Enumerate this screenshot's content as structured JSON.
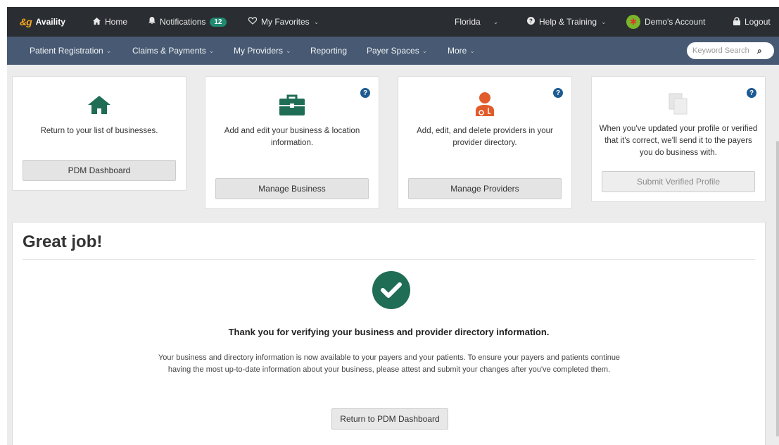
{
  "topbar": {
    "logo": "Availity",
    "home": "Home",
    "notifications": "Notifications",
    "notifications_count": "12",
    "favorites": "My Favorites",
    "state": "Florida",
    "help": "Help & Training",
    "account": "Demo's Account",
    "logout": "Logout"
  },
  "navbar": {
    "items": [
      "Patient Registration",
      "Claims & Payments",
      "My Providers",
      "Reporting",
      "Payer Spaces",
      "More"
    ],
    "search_placeholder": "Keyword Search"
  },
  "cards": [
    {
      "description": "Return to your list of businesses.",
      "button": "PDM Dashboard",
      "icon": "home-icon"
    },
    {
      "description": "Add and edit your business & location information.",
      "button": "Manage Business",
      "icon": "briefcase-icon"
    },
    {
      "description": "Add, edit, and delete providers in your provider directory.",
      "button": "Manage Providers",
      "icon": "doctor-icon"
    },
    {
      "description": "When you've updated your profile or verified that it's correct, we'll send it to the payers you do business with.",
      "button": "Submit Verified Profile",
      "icon": "documents-icon"
    }
  ],
  "panel": {
    "title": "Great job!",
    "thanks": "Thank you for verifying your business and provider directory information.",
    "paragraph": "Your business and directory information is now available to your payers and your patients. To ensure your payers and patients continue having the most up-to-date information about your business, please attest and submit your changes after you've completed them.",
    "button": "Return to PDM Dashboard"
  },
  "colors": {
    "topbar": "#2a2d31",
    "navbar": "#485a73",
    "accent_green": "#1f6d54",
    "help_blue": "#1d5b92",
    "doctor_orange": "#e25b2a"
  }
}
